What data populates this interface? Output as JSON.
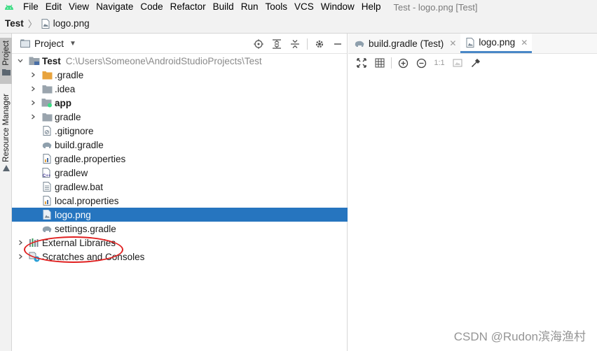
{
  "menubar": {
    "items": [
      "File",
      "Edit",
      "View",
      "Navigate",
      "Code",
      "Refactor",
      "Build",
      "Run",
      "Tools",
      "VCS",
      "Window",
      "Help"
    ],
    "window_title": "Test - logo.png [Test]"
  },
  "navbar": {
    "root": "Test",
    "file": "logo.png"
  },
  "toolstrip": {
    "project_tab": "Project",
    "resource_tab": "Resource Manager"
  },
  "project_panel": {
    "title": "Project",
    "tree": {
      "root_name": "Test",
      "root_path": "C:\\Users\\Someone\\AndroidStudioProjects\\Test",
      "items": [
        {
          "label": ".gradle"
        },
        {
          "label": ".idea"
        },
        {
          "label": "app"
        },
        {
          "label": "gradle"
        },
        {
          "label": ".gitignore"
        },
        {
          "label": "build.gradle"
        },
        {
          "label": "gradle.properties"
        },
        {
          "label": "gradlew"
        },
        {
          "label": "gradlew.bat"
        },
        {
          "label": "local.properties"
        },
        {
          "label": "logo.png"
        },
        {
          "label": "settings.gradle"
        }
      ],
      "external_libraries": "External Libraries",
      "scratches": "Scratches and Consoles"
    }
  },
  "editor": {
    "tabs": [
      {
        "label": "build.gradle (Test)"
      },
      {
        "label": "logo.png"
      }
    ],
    "ratio_label": "1:1"
  },
  "watermark": "CSDN @Rudon滨海渔村",
  "colors": {
    "selection": "#2675bf",
    "folder_orange": "#e8a33d",
    "folder_gray": "#9aa4ad",
    "highlight_red": "#e02020",
    "android_green": "#3ddc84"
  }
}
